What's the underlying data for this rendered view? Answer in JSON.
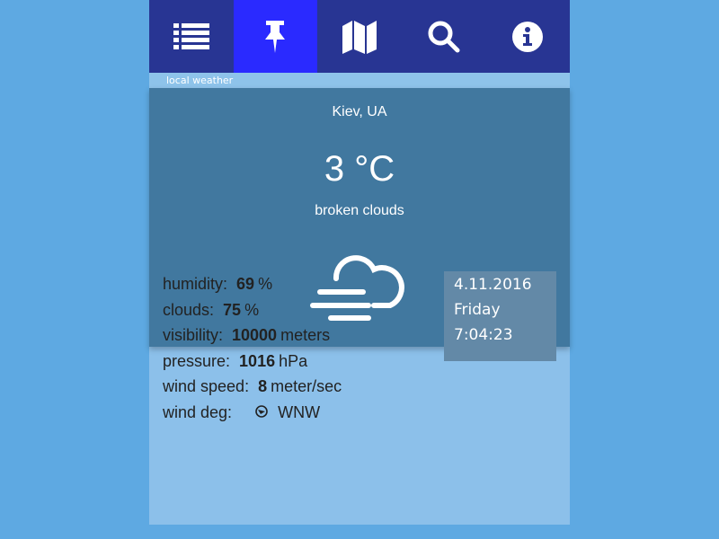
{
  "nav": {
    "items": [
      {
        "icon": "list-icon"
      },
      {
        "icon": "pushpin-icon",
        "active": true
      },
      {
        "icon": "map-icon"
      },
      {
        "icon": "search-icon"
      },
      {
        "icon": "info-icon"
      }
    ]
  },
  "section_label": "local weather",
  "weather": {
    "city": "Kiev, UA",
    "temperature": "3 °C",
    "description": "broken clouds",
    "icon": "cloud-fog-icon"
  },
  "details": [
    {
      "label": "humidity:",
      "value": "69",
      "unit": "%"
    },
    {
      "label": "clouds:",
      "value": "75",
      "unit": "%"
    },
    {
      "label": "visibility:",
      "value": "10000",
      "unit": "meters"
    },
    {
      "label": "pressure:",
      "value": "1016",
      "unit": "hPa"
    },
    {
      "label": "wind speed:",
      "value": "8",
      "unit": "meter/sec"
    },
    {
      "label": "wind deg:",
      "direction": "WNW"
    }
  ],
  "datetime": {
    "date": "4.11.2016",
    "weekday": "Friday",
    "time": "7:04:23"
  },
  "colors": {
    "nav": "#283593",
    "active": "#2a2aff",
    "main": "#41789f",
    "datebox": "#6389a7"
  }
}
